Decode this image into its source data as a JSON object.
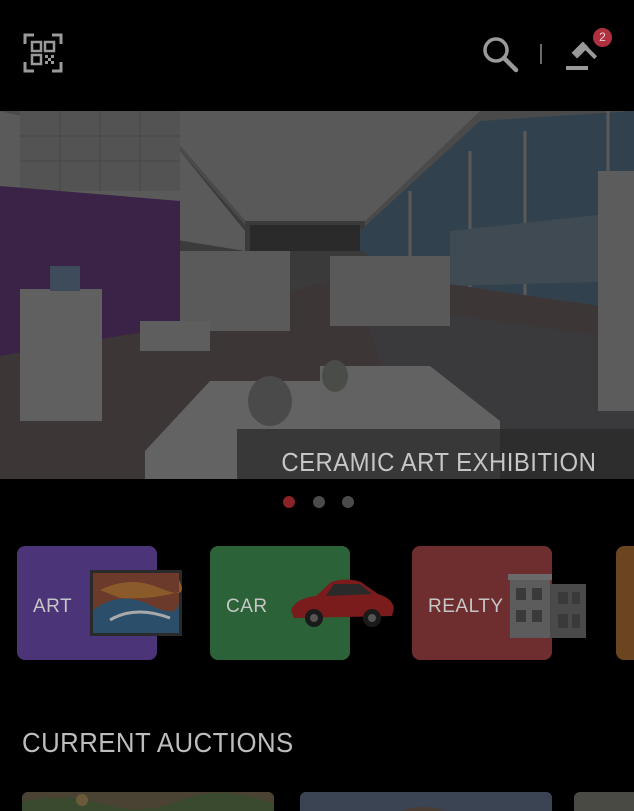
{
  "header": {
    "qr_icon": "qr-code-scan-icon",
    "search_icon": "search-icon",
    "auction_icon": "gavel-icon",
    "notification_count": "2"
  },
  "hero": {
    "caption": "CERAMIC ART EXHIBITION",
    "slides_total": 3,
    "active_slide": 1
  },
  "categories": [
    {
      "label": "ART",
      "color": "#5b3f94"
    },
    {
      "label": "CAR",
      "color": "#3b7a45"
    },
    {
      "label": "REALTY",
      "color": "#8a3a3c"
    },
    {
      "label": "",
      "color": "#8a5a2a"
    }
  ],
  "current_auctions": {
    "title": "CURRENT AUCTIONS"
  },
  "colors": {
    "background": "#000000",
    "badge": "#b03040",
    "dot_active": "#8b2228",
    "dot_inactive": "#4b4b4b"
  }
}
